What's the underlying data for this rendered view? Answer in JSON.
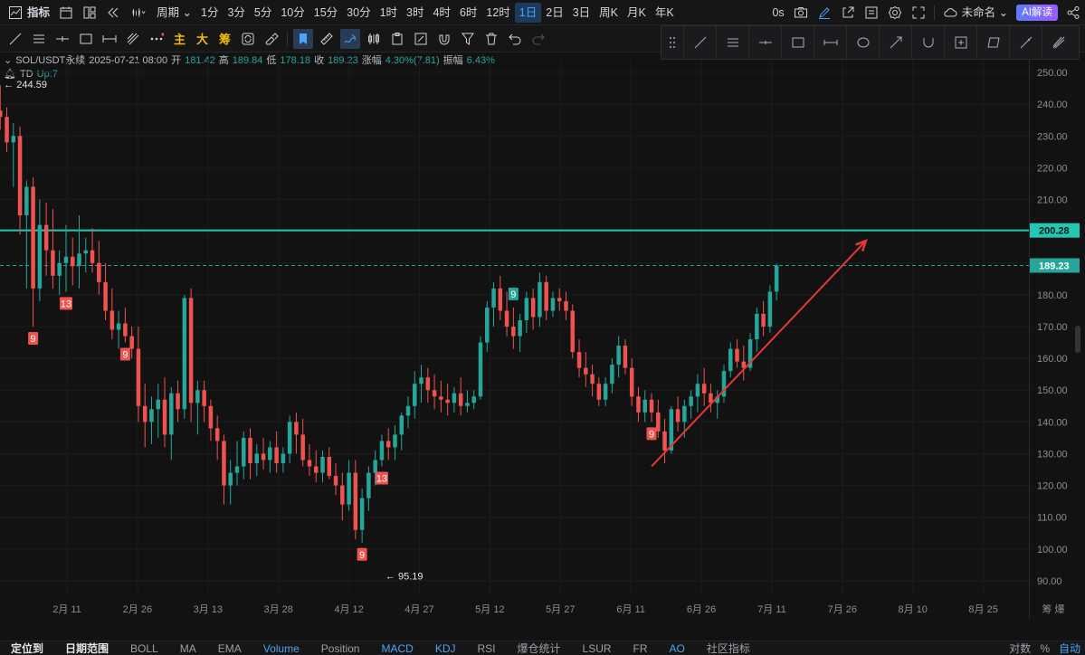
{
  "topbar": {
    "indicator_label": "指标",
    "period_label": "周期",
    "intervals": [
      "1分",
      "3分",
      "5分",
      "10分",
      "15分",
      "30分",
      "1时",
      "3时",
      "4时",
      "6时",
      "12时",
      "1日",
      "2日",
      "3日",
      "周K",
      "月K",
      "年K"
    ],
    "active_interval": "1日",
    "countdown": "0s",
    "layout_name": "未命名",
    "ai_label": "AI解读"
  },
  "drawbar": {
    "chars": [
      "主",
      "大",
      "筹"
    ]
  },
  "legend": {
    "symbol": "SOL/USDT永续",
    "date": "2025-07-21 08:00",
    "open_label": "开",
    "open": "181.42",
    "high_label": "高",
    "high": "189.84",
    "low_label": "低",
    "low": "178.18",
    "close_label": "收",
    "close": "189.23",
    "change_label": "涨幅",
    "change": "4.30%(7.81)",
    "amplitude_label": "振幅",
    "amplitude": "6.43%",
    "td_label": "TD",
    "td_value": "Up:7"
  },
  "bottombar": {
    "items": [
      "定位到",
      "日期范围",
      "BOLL",
      "MA",
      "EMA",
      "Volume",
      "Position",
      "MACD",
      "KDJ",
      "RSI",
      "爆仓统计",
      "LSUR",
      "FR",
      "AO",
      "社区指标"
    ],
    "active": [
      "Volume",
      "MACD",
      "KDJ",
      "AO"
    ],
    "right": [
      "对数",
      "%",
      "自动"
    ]
  },
  "colors": {
    "up": "#26a69a",
    "down": "#ef5350",
    "hline": "#26c6b4",
    "arrow": "#e53935",
    "bg": "#121212"
  },
  "chart_data": {
    "type": "candlestick",
    "title": "",
    "yticks": [
      90,
      100,
      110,
      120,
      130,
      140,
      150,
      160,
      170,
      180,
      190,
      200,
      210,
      220,
      230,
      240,
      250
    ],
    "ylim": [
      86,
      254
    ],
    "xticks": [
      {
        "label": "2月 11",
        "day": 42
      },
      {
        "label": "2月 26",
        "day": 57
      },
      {
        "label": "3月 13",
        "day": 72
      },
      {
        "label": "3月 28",
        "day": 87
      },
      {
        "label": "4月 12",
        "day": 102
      },
      {
        "label": "4月 27",
        "day": 117
      },
      {
        "label": "5月 12",
        "day": 132
      },
      {
        "label": "5月 27",
        "day": 147
      },
      {
        "label": "6月 11",
        "day": 162
      },
      {
        "label": "6月 26",
        "day": 177
      },
      {
        "label": "7月 11",
        "day": 192
      },
      {
        "label": "7月 26",
        "day": 207
      },
      {
        "label": "8月 10",
        "day": 222
      },
      {
        "label": "8月 25",
        "day": 237
      }
    ],
    "xaxis_extra": "筹 爆",
    "first_candle_day": 25,
    "candles_ohlc": [
      [
        224,
        231,
        220,
        226
      ],
      [
        226,
        241,
        222,
        238
      ],
      [
        238,
        246,
        232,
        236
      ],
      [
        236,
        239,
        225,
        228
      ],
      [
        228,
        234,
        214,
        230
      ],
      [
        230,
        233,
        199,
        205
      ],
      [
        205,
        216,
        182,
        214
      ],
      [
        214,
        217,
        170,
        182
      ],
      [
        182,
        210,
        178,
        202
      ],
      [
        202,
        209,
        186,
        194
      ],
      [
        194,
        207,
        182,
        186
      ],
      [
        186,
        194,
        180,
        190
      ],
      [
        190,
        202,
        181,
        192
      ],
      [
        192,
        198,
        183,
        189
      ],
      [
        189,
        205,
        182,
        193
      ],
      [
        193,
        198,
        187,
        194
      ],
      [
        194,
        201,
        187,
        190
      ],
      [
        190,
        197,
        180,
        184
      ],
      [
        184,
        190,
        172,
        175
      ],
      [
        175,
        182,
        166,
        169
      ],
      [
        169,
        175,
        163,
        171
      ],
      [
        171,
        176,
        165,
        167
      ],
      [
        167,
        170,
        160,
        163
      ],
      [
        163,
        170,
        140,
        145
      ],
      [
        145,
        152,
        132,
        140
      ],
      [
        140,
        148,
        133,
        144
      ],
      [
        144,
        152,
        135,
        147
      ],
      [
        147,
        154,
        132,
        136
      ],
      [
        136,
        151,
        128,
        149
      ],
      [
        149,
        153,
        140,
        144
      ],
      [
        144,
        180,
        141,
        179
      ],
      [
        179,
        182,
        140,
        146
      ],
      [
        146,
        153,
        136,
        150
      ],
      [
        150,
        153,
        140,
        145
      ],
      [
        145,
        147,
        134,
        138
      ],
      [
        138,
        142,
        128,
        134
      ],
      [
        134,
        136,
        114,
        120
      ],
      [
        120,
        128,
        114,
        124
      ],
      [
        124,
        134,
        120,
        126
      ],
      [
        126,
        137,
        122,
        135
      ],
      [
        135,
        138,
        122,
        127
      ],
      [
        127,
        133,
        123,
        130
      ],
      [
        130,
        135,
        125,
        128
      ],
      [
        128,
        134,
        124,
        132
      ],
      [
        132,
        137,
        124,
        127
      ],
      [
        127,
        132,
        124,
        130
      ],
      [
        130,
        142,
        127,
        140
      ],
      [
        140,
        143,
        130,
        136
      ],
      [
        136,
        141,
        126,
        128
      ],
      [
        128,
        133,
        123,
        126
      ],
      [
        126,
        131,
        121,
        124
      ],
      [
        124,
        131,
        121,
        129
      ],
      [
        129,
        132,
        122,
        123
      ],
      [
        123,
        127,
        117,
        120
      ],
      [
        120,
        124,
        109,
        114
      ],
      [
        114,
        128,
        112,
        124
      ],
      [
        124,
        128,
        103,
        106
      ],
      [
        106,
        119,
        102,
        116
      ],
      [
        116,
        126,
        112,
        124
      ],
      [
        124,
        131,
        120,
        128
      ],
      [
        128,
        136,
        126,
        134
      ],
      [
        134,
        138,
        128,
        132
      ],
      [
        132,
        139,
        128,
        136
      ],
      [
        136,
        143,
        131,
        142
      ],
      [
        142,
        148,
        138,
        145
      ],
      [
        145,
        156,
        141,
        152
      ],
      [
        152,
        158,
        146,
        154
      ],
      [
        154,
        157,
        146,
        150
      ],
      [
        150,
        155,
        144,
        148
      ],
      [
        148,
        153,
        143,
        147
      ],
      [
        147,
        152,
        142,
        146
      ],
      [
        146,
        151,
        143,
        149
      ],
      [
        149,
        154,
        142,
        145
      ],
      [
        145,
        150,
        143,
        146
      ],
      [
        146,
        150,
        144,
        148
      ],
      [
        148,
        167,
        147,
        165
      ],
      [
        165,
        178,
        162,
        176
      ],
      [
        176,
        184,
        170,
        182
      ],
      [
        182,
        186,
        172,
        175
      ],
      [
        175,
        181,
        167,
        170
      ],
      [
        170,
        176,
        163,
        167
      ],
      [
        167,
        174,
        162,
        172
      ],
      [
        172,
        181,
        168,
        179
      ],
      [
        179,
        182,
        169,
        173
      ],
      [
        173,
        187,
        170,
        184
      ],
      [
        184,
        186,
        172,
        175
      ],
      [
        175,
        181,
        173,
        179
      ],
      [
        179,
        182,
        175,
        178
      ],
      [
        178,
        181,
        172,
        175
      ],
      [
        175,
        177,
        160,
        162
      ],
      [
        162,
        166,
        154,
        157
      ],
      [
        157,
        162,
        151,
        155
      ],
      [
        155,
        158,
        148,
        152
      ],
      [
        152,
        154,
        145,
        147
      ],
      [
        147,
        154,
        145,
        152
      ],
      [
        152,
        160,
        149,
        158
      ],
      [
        158,
        167,
        154,
        164
      ],
      [
        164,
        166,
        155,
        157
      ],
      [
        157,
        160,
        145,
        148
      ],
      [
        148,
        151,
        140,
        143
      ],
      [
        143,
        150,
        140,
        147
      ],
      [
        147,
        149,
        140,
        143
      ],
      [
        143,
        147,
        135,
        137
      ],
      [
        137,
        141,
        127,
        131
      ],
      [
        131,
        145,
        130,
        144
      ],
      [
        144,
        148,
        137,
        140
      ],
      [
        140,
        147,
        135,
        145
      ],
      [
        145,
        150,
        141,
        148
      ],
      [
        148,
        155,
        143,
        152
      ],
      [
        152,
        157,
        145,
        149
      ],
      [
        149,
        152,
        143,
        146
      ],
      [
        146,
        150,
        141,
        148
      ],
      [
        148,
        158,
        146,
        156
      ],
      [
        156,
        165,
        154,
        163
      ],
      [
        163,
        166,
        157,
        159
      ],
      [
        159,
        164,
        153,
        157
      ],
      [
        157,
        168,
        156,
        166
      ],
      [
        166,
        176,
        162,
        174
      ],
      [
        174,
        178,
        167,
        170
      ],
      [
        170,
        183,
        168,
        181
      ],
      [
        181,
        189.84,
        178.18,
        189.23
      ]
    ],
    "td_marks": [
      {
        "text": "13",
        "candle": 12,
        "pos": "below",
        "color": "down"
      },
      {
        "text": "9",
        "candle": 7,
        "pos": "below",
        "color": "down"
      },
      {
        "text": "9",
        "candle": 21,
        "pos": "below",
        "color": "down"
      },
      {
        "text": "9",
        "candle": 57,
        "pos": "below",
        "color": "down"
      },
      {
        "text": "13",
        "candle": 60,
        "pos": "below",
        "color": "down"
      },
      {
        "text": "9",
        "candle": 80,
        "pos": "above",
        "color": "up"
      },
      {
        "text": "9",
        "candle": 101,
        "pos": "below",
        "color": "down"
      }
    ],
    "extremes": [
      {
        "label": "244.59",
        "price": 244.59,
        "candle": 2
      },
      {
        "label": "95.19",
        "price": 95.19,
        "candle": 60
      }
    ],
    "horizontal_line": {
      "price": 200.28,
      "label": "200.28"
    },
    "last_price": {
      "price": 189.23,
      "label": "189.23"
    },
    "trend_arrow": {
      "from_candle": 101,
      "from_price": 126,
      "to_day": 212,
      "to_price": 197
    }
  }
}
